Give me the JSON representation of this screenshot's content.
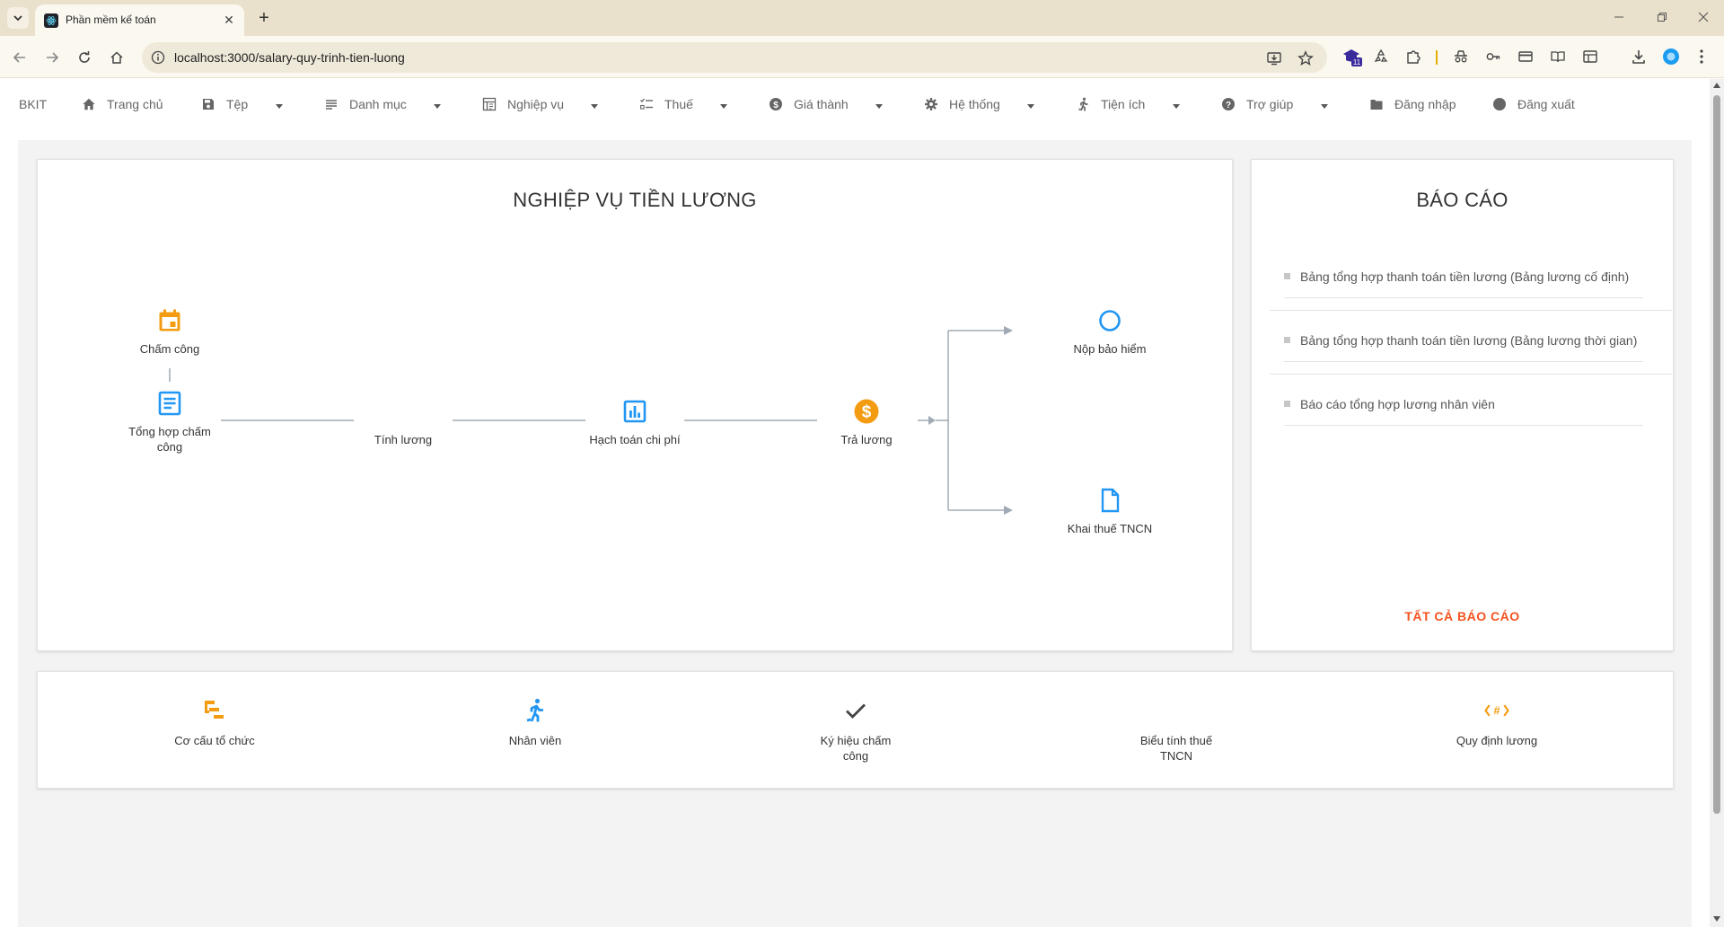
{
  "browser": {
    "tab_title": "Phần mềm kế toán",
    "url": "localhost:3000/salary-quy-trinh-tien-luong",
    "extension_badge": "11"
  },
  "menu": {
    "brand": "BKIT",
    "items": [
      {
        "label": "Trang chủ",
        "icon": "home-icon",
        "dropdown": false
      },
      {
        "label": "Tệp",
        "icon": "save-icon",
        "dropdown": true
      },
      {
        "label": "Danh mục",
        "icon": "list-icon",
        "dropdown": true
      },
      {
        "label": "Nghiệp vụ",
        "icon": "dashboard-icon",
        "dropdown": true
      },
      {
        "label": "Thuế",
        "icon": "checklist-icon",
        "dropdown": true
      },
      {
        "label": "Giá thành",
        "icon": "dollar-icon",
        "dropdown": true
      },
      {
        "label": "Hệ thống",
        "icon": "gear-icon",
        "dropdown": true
      },
      {
        "label": "Tiện ích",
        "icon": "runner-icon",
        "dropdown": true
      },
      {
        "label": "Trợ giúp",
        "icon": "help-icon",
        "dropdown": true
      },
      {
        "label": "Đăng nhập",
        "icon": "folder-icon",
        "dropdown": false
      },
      {
        "label": "Đăng xuất",
        "icon": "circle-icon",
        "dropdown": false
      }
    ]
  },
  "salary": {
    "title": "NGHIỆP VỤ TIỀN LƯƠNG",
    "nodes": {
      "cham_cong": "Chấm công",
      "tong_hop_line1": "Tổng hợp chấm",
      "tong_hop_line2": "công",
      "tinh_luong": "Tính lương",
      "hach_toan": "Hạch toán chi phí",
      "tra_luong": "Trả lương",
      "nop_bao_hiem": "Nộp bảo hiểm",
      "khai_thue": "Khai thuế TNCN"
    }
  },
  "reports": {
    "title": "BÁO CÁO",
    "items": [
      "Bảng tổng hợp thanh toán tiền lương (Bảng lương cố định)",
      "Bảng tổng hợp thanh toán tiền lương (Bảng lương thời gian)",
      "Báo cáo tổng hợp lương nhân viên"
    ],
    "all_label": "TẤT CẢ BÁO CÁO"
  },
  "shortcuts": {
    "co_cau": "Cơ cấu tổ chức",
    "nhan_vien": "Nhân viên",
    "ky_hieu_line1": "Ký hiệu chấm",
    "ky_hieu_line2": "công",
    "bieu_thue_line1": "Biểu tính thuế",
    "bieu_thue_line2": "TNCN",
    "quy_dinh": "Quy định lương"
  },
  "colors": {
    "orange": "#f39c12",
    "blue": "#2196f3",
    "accent_red": "#f4511e",
    "connector": "#a0aab4"
  }
}
